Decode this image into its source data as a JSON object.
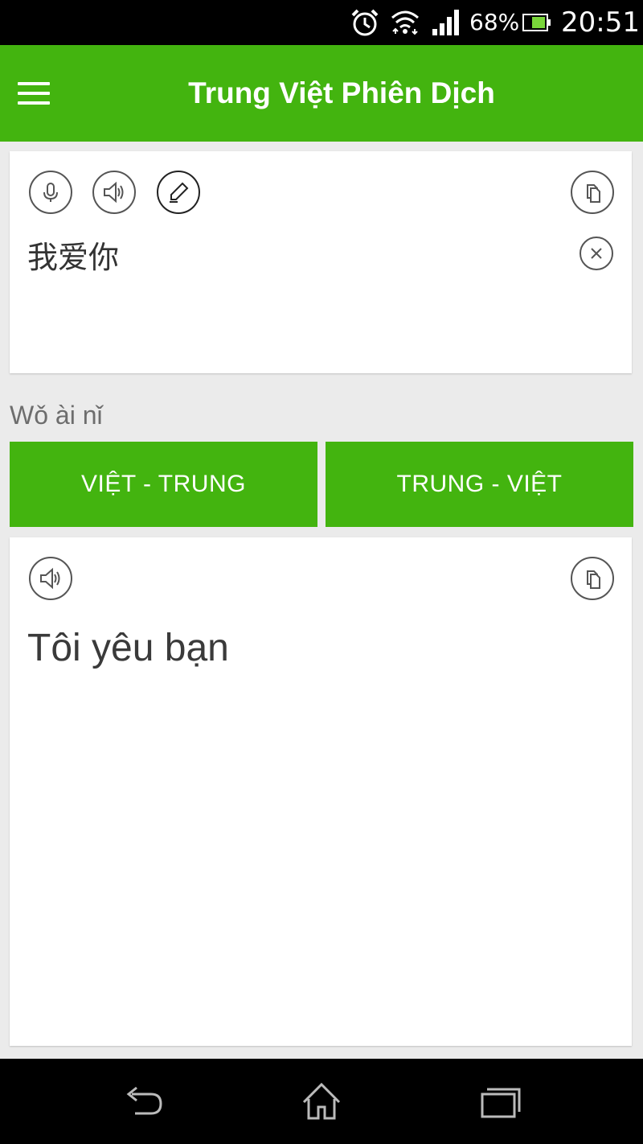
{
  "status_bar": {
    "battery_percent": "68%",
    "time": "20:51"
  },
  "app_bar": {
    "title": "Trung Việt Phiên Dịch"
  },
  "input_card": {
    "source_text": "我爱你"
  },
  "pinyin": "Wǒ ài nǐ",
  "lang_buttons": {
    "viet_trung": "VIỆT - TRUNG",
    "trung_viet": "TRUNG - VIỆT"
  },
  "output_card": {
    "result_text": "Tôi yêu bạn"
  },
  "colors": {
    "accent": "#43b40f",
    "background": "#ebebeb",
    "text": "#333333"
  }
}
